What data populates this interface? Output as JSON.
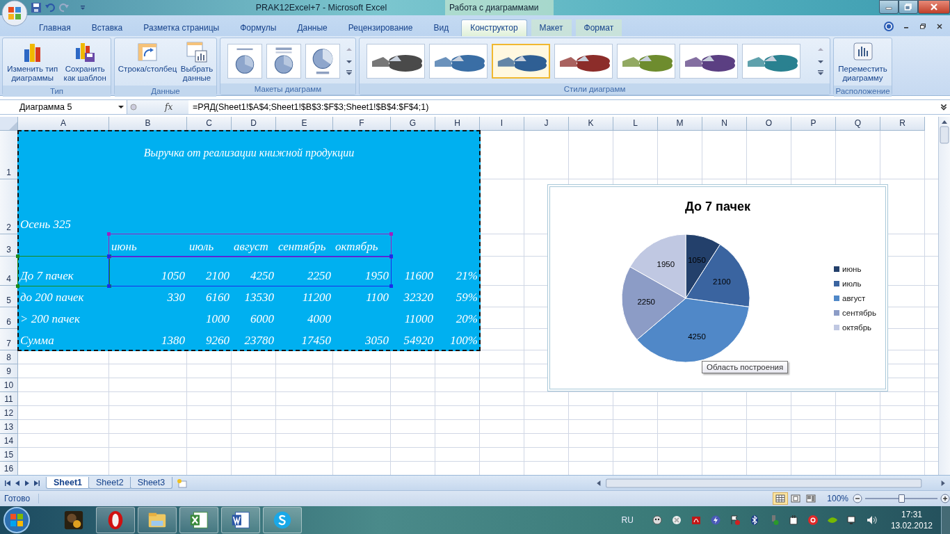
{
  "window": {
    "title": "PRAK12Excel+7  -  Microsoft Excel",
    "context_title": "Работа с диаграммами"
  },
  "tabs": [
    {
      "label": "Главная",
      "selected": false,
      "contextual": false
    },
    {
      "label": "Вставка",
      "selected": false,
      "contextual": false
    },
    {
      "label": "Разметка страницы",
      "selected": false,
      "contextual": false
    },
    {
      "label": "Формулы",
      "selected": false,
      "contextual": false
    },
    {
      "label": "Данные",
      "selected": false,
      "contextual": false
    },
    {
      "label": "Рецензирование",
      "selected": false,
      "contextual": false
    },
    {
      "label": "Вид",
      "selected": false,
      "contextual": false
    },
    {
      "label": "Конструктор",
      "selected": true,
      "contextual": true
    },
    {
      "label": "Макет",
      "selected": false,
      "contextual": true
    },
    {
      "label": "Формат",
      "selected": false,
      "contextual": true
    }
  ],
  "ribbon_groups": [
    {
      "title": "Тип",
      "kind": "buttons",
      "buttons": [
        {
          "label": "Изменить тип\nдиаграммы",
          "kind": "chart-type"
        },
        {
          "label": "Сохранить\nкак шаблон",
          "kind": "save-template"
        }
      ]
    },
    {
      "title": "Данные",
      "kind": "buttons",
      "buttons": [
        {
          "label": "Строка/столбец",
          "kind": "switch"
        },
        {
          "label": "Выбрать\nданные",
          "kind": "select-data"
        }
      ]
    },
    {
      "title": "Макеты диаграмм",
      "kind": "gallery",
      "items": [
        {
          "kind": "layout-labels",
          "selected": false
        },
        {
          "kind": "layout-title",
          "selected": false
        },
        {
          "kind": "layout-legend",
          "selected": false
        }
      ]
    },
    {
      "title": "Стили диаграмм",
      "kind": "gallery",
      "items": [
        {
          "kind": "style",
          "color": "#4a4a4a",
          "selected": false
        },
        {
          "kind": "style",
          "color": "#3a6ea5",
          "selected": false
        },
        {
          "kind": "style",
          "color": "#2f5f94",
          "selected": true
        },
        {
          "kind": "style",
          "color": "#8c2d2a",
          "selected": false
        },
        {
          "kind": "style",
          "color": "#6e8c2e",
          "selected": false
        },
        {
          "kind": "style",
          "color": "#5b3f82",
          "selected": false
        },
        {
          "kind": "style",
          "color": "#2a8190",
          "selected": false
        }
      ]
    },
    {
      "title": "Расположение",
      "kind": "buttons",
      "buttons": [
        {
          "label": "Переместить\nдиаграмму",
          "kind": "move"
        }
      ]
    }
  ],
  "formula_bar": {
    "name_box": "Диаграмма 5",
    "function_label": "fx",
    "formula": "=РЯД(Sheet1!$A$4;Sheet1!$B$3:$F$3;Sheet1!$B$4:$F$4;1)"
  },
  "sheet": {
    "columns": [
      "A",
      "B",
      "C",
      "D",
      "E",
      "F",
      "G",
      "H",
      "I",
      "J",
      "K",
      "L",
      "M",
      "N",
      "O",
      "P",
      "Q",
      "R"
    ],
    "title": "Выручка от реализации книжной продукции",
    "rows": [
      {
        "number": "1",
        "kind": "title",
        "cells": []
      },
      {
        "number": "2",
        "kind": "label",
        "cells": [
          "Осень 325",
          "",
          "",
          "",
          "",
          "",
          "",
          ""
        ]
      },
      {
        "number": "3",
        "kind": "header",
        "cells": [
          "",
          "июнь",
          "июль",
          "август",
          "сентябрь",
          "октябрь",
          "",
          ""
        ]
      },
      {
        "number": "4",
        "kind": "data",
        "cells": [
          "До 7 пачек",
          "1050",
          "2100",
          "4250",
          "2250",
          "1950",
          "11600",
          "21%"
        ]
      },
      {
        "number": "5",
        "kind": "data",
        "cells": [
          "до 200 пачек",
          "330",
          "6160",
          "13530",
          "11200",
          "1100",
          "32320",
          "59%"
        ]
      },
      {
        "number": "6",
        "kind": "data",
        "cells": [
          "> 200 пачек",
          "",
          "1000",
          "6000",
          "4000",
          "",
          "11000",
          "20%"
        ]
      },
      {
        "number": "7",
        "kind": "data",
        "cells": [
          "Сумма",
          "1380",
          "9260",
          "23780",
          "17450",
          "3050",
          "54920",
          "100%"
        ]
      },
      {
        "number": "8",
        "kind": "empty",
        "cells": []
      },
      {
        "number": "9",
        "kind": "empty",
        "cells": []
      },
      {
        "number": "10",
        "kind": "empty",
        "cells": []
      },
      {
        "number": "11",
        "kind": "empty",
        "cells": []
      },
      {
        "number": "12",
        "kind": "empty",
        "cells": []
      },
      {
        "number": "13",
        "kind": "empty",
        "cells": []
      },
      {
        "number": "14",
        "kind": "empty",
        "cells": []
      },
      {
        "number": "15",
        "kind": "empty",
        "cells": []
      },
      {
        "number": "16",
        "kind": "empty",
        "cells": []
      }
    ]
  },
  "chart": {
    "selected": true,
    "tooltip": "Область построения",
    "chart_data": {
      "type": "pie",
      "title": "До 7 пачек",
      "categories": [
        "июнь",
        "июль",
        "август",
        "сентябрь",
        "октябрь"
      ],
      "values": [
        1050,
        2100,
        4250,
        2250,
        1950
      ],
      "value_labels": [
        "1050",
        "2100",
        "4250",
        "2250",
        "1950"
      ],
      "legend": "right"
    },
    "legend": [
      {
        "color": "#23406b"
      },
      {
        "color": "#3a64a0"
      },
      {
        "color": "#5088c8"
      },
      {
        "color": "#8c9cc6"
      },
      {
        "color": "#c0c8e2"
      }
    ]
  },
  "sheet_tabs": [
    {
      "label": "Sheet1",
      "selected": true
    },
    {
      "label": "Sheet2",
      "selected": false
    },
    {
      "label": "Sheet3",
      "selected": false
    }
  ],
  "status_bar": {
    "text": "Готово",
    "views": [
      {
        "kind": "normal",
        "selected": true
      },
      {
        "kind": "layout",
        "selected": false
      },
      {
        "kind": "break",
        "selected": false
      }
    ],
    "zoom": "100%",
    "zoom_level": {
      "level": 0.5
    }
  },
  "taskbar": {
    "apps": [
      {
        "kind": "media",
        "running": false
      },
      {
        "kind": "opera",
        "running": true
      },
      {
        "kind": "explorer",
        "running": true
      },
      {
        "kind": "excel",
        "running": true
      },
      {
        "kind": "word",
        "running": true
      },
      {
        "kind": "skype",
        "running": true
      }
    ],
    "language": "RU",
    "tray": [
      {
        "kind": "ghost"
      },
      {
        "kind": "cross"
      },
      {
        "kind": "pdf"
      },
      {
        "kind": "bolt"
      },
      {
        "kind": "flag"
      },
      {
        "kind": "bluetooth"
      },
      {
        "kind": "usb"
      },
      {
        "kind": "plug"
      },
      {
        "kind": "record"
      },
      {
        "kind": "nvidia"
      },
      {
        "kind": "network"
      },
      {
        "kind": "volume"
      }
    ],
    "time": "17:31",
    "date": "13.02.2012"
  }
}
